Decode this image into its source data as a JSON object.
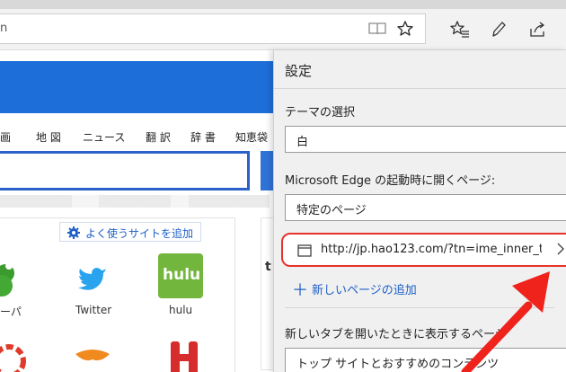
{
  "address_bar": {
    "url_fragment": "n"
  },
  "webpage": {
    "nav_links": [
      "画",
      "地 図",
      "ニュース",
      "翻 訳",
      "辞 書",
      "知恵袋"
    ],
    "add_site_label": "よく使うサイトを追加",
    "tiles": [
      {
        "label": "ーパ"
      },
      {
        "label": "Twitter"
      },
      {
        "label": "hulu",
        "tile_text": "hulu"
      }
    ],
    "right_column_char": "t"
  },
  "settings": {
    "title": "設定",
    "theme": {
      "label": "テーマの選択",
      "value": "白"
    },
    "startup": {
      "label": "Microsoft Edge の起動時に開くページ:",
      "value": "特定のページ",
      "url": "http://jp.hao123.com/?tn=ime_inner_t",
      "add_page_label": "新しいページの追加"
    },
    "new_tab": {
      "label": "新しいタブを開いたときに表示するページ",
      "value": "トップ サイトとおすすめのコンテンツ"
    }
  },
  "colors": {
    "accent_blue": "#1e6ed9",
    "highlight_red": "#e8322b",
    "link_blue": "#1e5fc7"
  },
  "icons": [
    "reading-view-icon",
    "favorite-star-icon",
    "favorites-list-icon",
    "web-note-pen-icon",
    "share-icon",
    "gear-icon",
    "page-icon",
    "chevron-right-icon",
    "plus-icon"
  ]
}
